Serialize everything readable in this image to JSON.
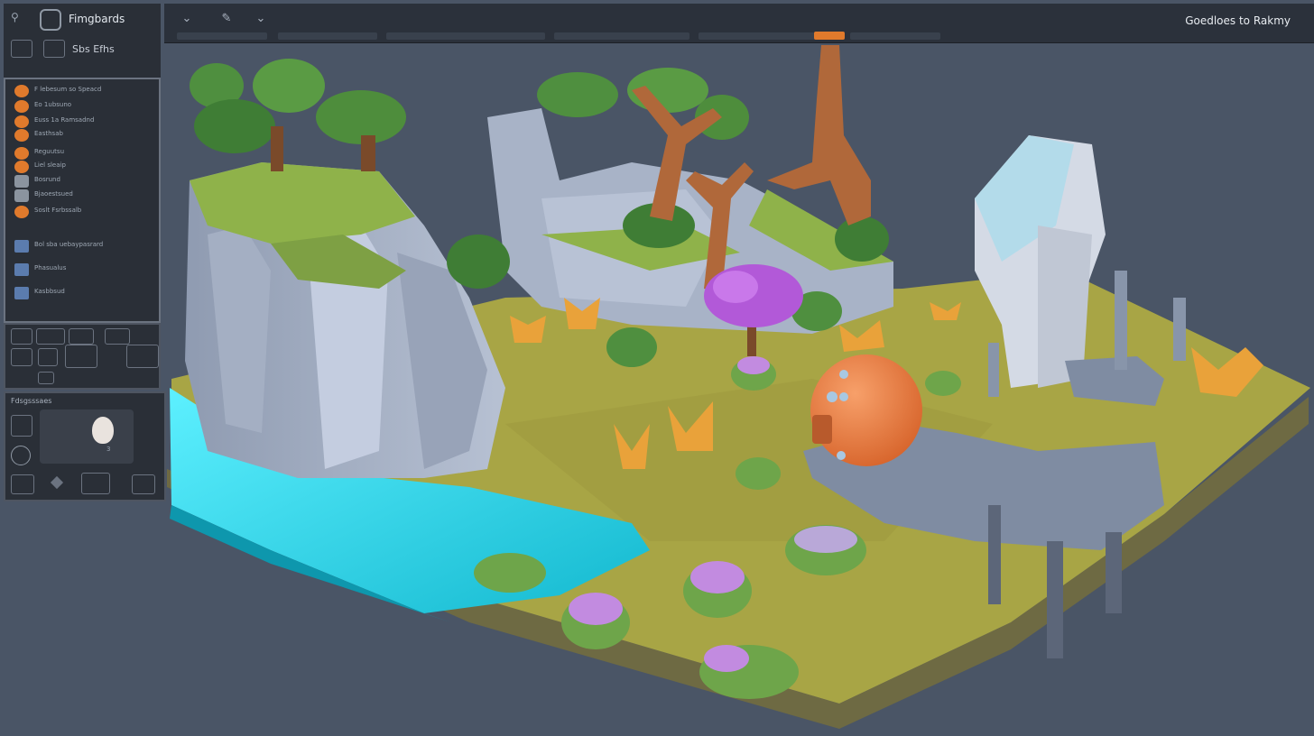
{
  "app": {
    "title": "Fimgbards",
    "subtitle": "Sbs Efhs",
    "viewport_title": "Goedloes to Rakmy"
  },
  "layers": {
    "items": [
      {
        "label": "F lebesum so Speacd",
        "icon": "orange"
      },
      {
        "label": "Eo 1ubsuno",
        "icon": "orange"
      },
      {
        "label": "Euss 1a Ramsadnd",
        "icon": "orange"
      },
      {
        "label": "Easthsab",
        "icon": "orange"
      },
      {
        "label": "Reguutsu",
        "icon": "orange"
      },
      {
        "label": "Liel sleaip",
        "icon": "orange"
      },
      {
        "label": "Bosrund",
        "icon": "gray"
      },
      {
        "label": "Bjaoestsued",
        "icon": "gray"
      },
      {
        "label": "Soslt Fsrbssalb",
        "icon": "orange"
      },
      {
        "label": "Bol sba uebaypasrard",
        "icon": "blue"
      },
      {
        "label": "Phasualus",
        "icon": "blue"
      },
      {
        "label": "Kasbbsud",
        "icon": "blue"
      }
    ]
  },
  "properties": {
    "label": "Fdsgsssaes",
    "preview_value": "3"
  },
  "colors": {
    "accent": "#e07a2c",
    "panel_bg": "#2a2f37",
    "viewport_bg": "#4a5566",
    "water": "#2fd6e0",
    "grass": "#a8a545"
  }
}
